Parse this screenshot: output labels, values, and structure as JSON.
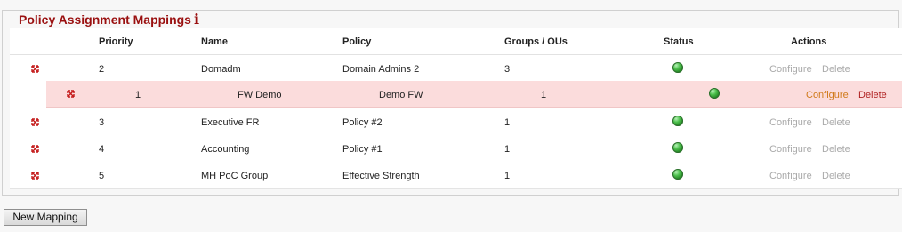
{
  "panel": {
    "title": "Policy Assignment Mappings",
    "info_glyph": "i"
  },
  "table": {
    "headers": {
      "priority": "Priority",
      "name": "Name",
      "policy": "Policy",
      "groups": "Groups / OUs",
      "status": "Status",
      "actions": "Actions"
    },
    "rows": [
      {
        "priority": "2",
        "name": "Domadm",
        "policy": "Domain Admins 2",
        "groups": "3",
        "status": "green",
        "configure": "Configure",
        "delete": "Delete"
      },
      {
        "priority": "3",
        "name": "Executive FR",
        "policy": "Policy #2",
        "groups": "1",
        "status": "green",
        "configure": "Configure",
        "delete": "Delete"
      },
      {
        "priority": "4",
        "name": "Accounting",
        "policy": "Policy #1",
        "groups": "1",
        "status": "green",
        "configure": "Configure",
        "delete": "Delete"
      },
      {
        "priority": "5",
        "name": "MH PoC Group",
        "policy": "Effective Strength",
        "groups": "1",
        "status": "green",
        "configure": "Configure",
        "delete": "Delete"
      }
    ],
    "dragged_row": {
      "priority": "1",
      "name": "FW Demo",
      "policy": "Demo FW",
      "groups": "1",
      "status": "green",
      "configure": "Configure",
      "delete": "Delete"
    }
  },
  "buttons": {
    "new_mapping": "New Mapping"
  },
  "icons": {
    "drag_handle": "drag-arrows-icon",
    "status_ok": "green-status-orb-icon",
    "info": "info-icon"
  },
  "colors": {
    "title": "#9a1010",
    "highlight_row": "#fbdcdc",
    "configure_active": "#d07a1a",
    "delete_active": "#b02222",
    "action_disabled": "#aaaaaa",
    "drag_icon": "#c41a1a"
  }
}
